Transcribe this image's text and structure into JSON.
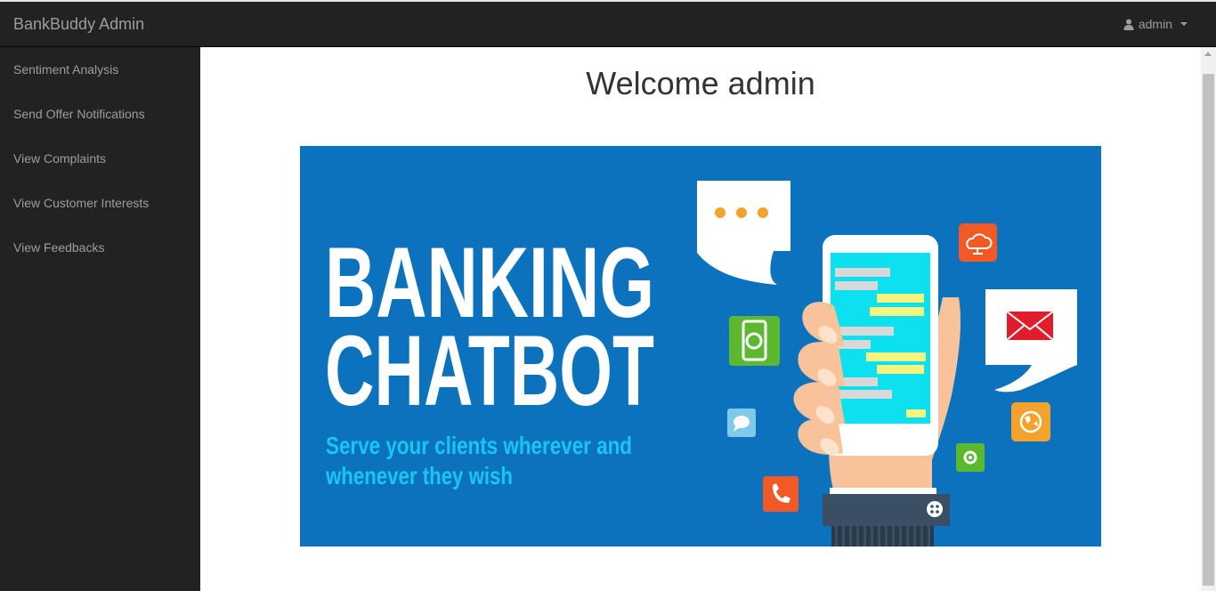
{
  "header": {
    "brand": "BankBuddy Admin",
    "user_label": "admin"
  },
  "sidebar": {
    "items": [
      {
        "label": "Sentiment Analysis"
      },
      {
        "label": "Send Offer Notifications"
      },
      {
        "label": "View Complaints"
      },
      {
        "label": "View Customer Interests"
      },
      {
        "label": "View Feedbacks"
      }
    ]
  },
  "main": {
    "title": "Welcome admin",
    "banner": {
      "line1": "BANKING",
      "line2": "CHATBOT",
      "tagline1": "Serve your clients wherever and",
      "tagline2": "whenever they wish"
    }
  },
  "colors": {
    "navbar": "#222222",
    "banner_bg": "#0d72be",
    "tagline": "#19c6f2"
  }
}
